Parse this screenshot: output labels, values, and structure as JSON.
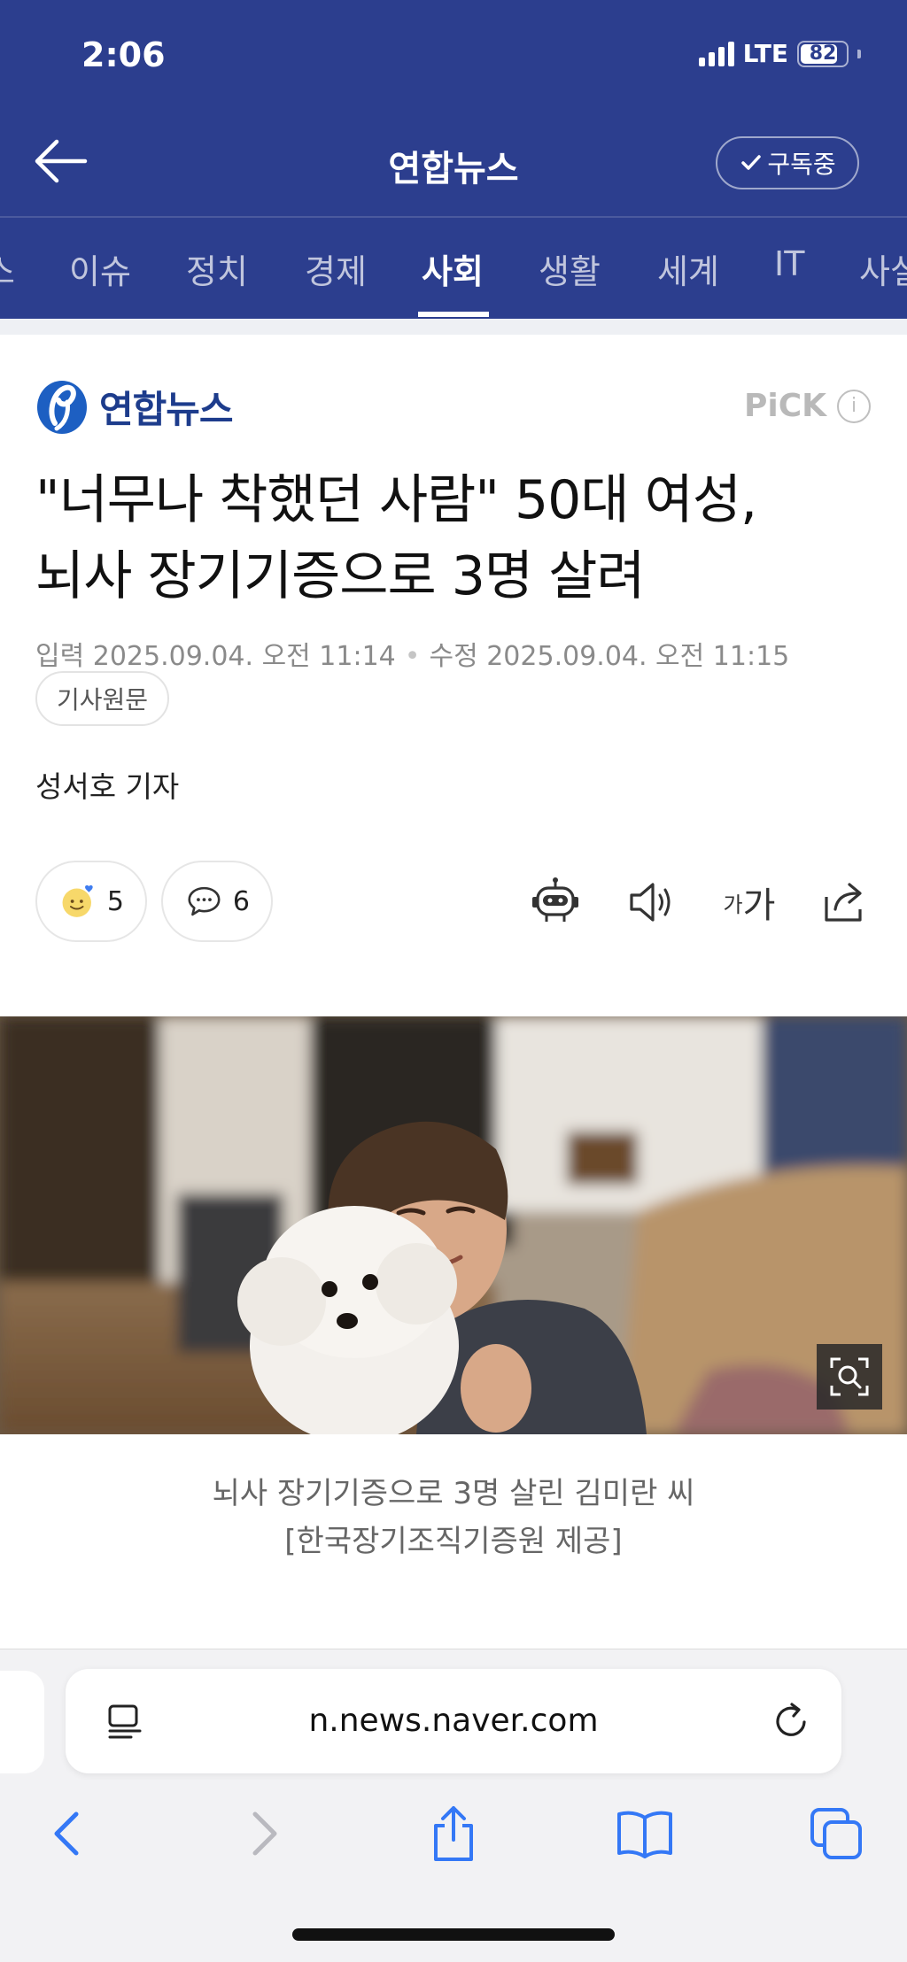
{
  "status_bar": {
    "time": "2:06",
    "network": "LTE",
    "battery": "82",
    "battery_level": 0.82
  },
  "header": {
    "title": "연합뉴스",
    "subscribe_label": "구독중"
  },
  "tabs": [
    {
      "label": "스"
    },
    {
      "label": "이슈"
    },
    {
      "label": "정치"
    },
    {
      "label": "경제"
    },
    {
      "label": "사회",
      "active": true
    },
    {
      "label": "생활"
    },
    {
      "label": "세계"
    },
    {
      "label": "IT"
    },
    {
      "label": "사설"
    }
  ],
  "article": {
    "press_name": "연합뉴스",
    "pick_label": "PiCK",
    "info_icon": "i",
    "headline_line1": "\"너무나 착했던 사람\" 50대 여성,",
    "headline_line2": "뇌사 장기기증으로 3명 살려",
    "input_date": "입력 2025.09.04. 오전 11:14",
    "modified_date": "수정 2025.09.04. 오전 11:15",
    "original_link_label": "기사원문",
    "reporter": "성서호 기자",
    "like_count": "5",
    "comment_count": "6",
    "font_size_small": "가",
    "font_size_large": "가",
    "caption_line1": "뇌사 장기기증으로 3명 살린 김미란 씨",
    "caption_line2": "[한국장기조직기증원 제공]"
  },
  "browser": {
    "url": "n.news.naver.com"
  },
  "colors": {
    "header_bg": "#2c3e8e",
    "brand_blue": "#1d3c8c",
    "safari_blue": "#3478f6"
  }
}
